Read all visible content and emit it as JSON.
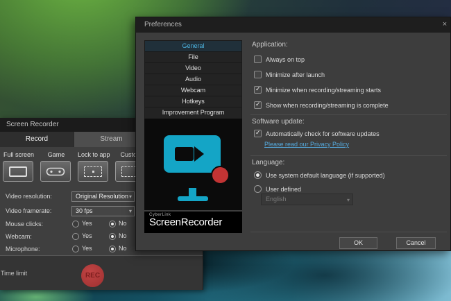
{
  "recorder_window": {
    "title": "Screen Recorder",
    "tabs": {
      "record": "Record",
      "stream": "Stream"
    },
    "modes": [
      {
        "label": "Full screen"
      },
      {
        "label": "Game"
      },
      {
        "label": "Lock to app"
      },
      {
        "label": "Custom"
      }
    ],
    "settings": [
      {
        "label": "Video resolution:",
        "value": "Original Resolution"
      },
      {
        "label": "Video framerate:",
        "value": "30 fps"
      },
      {
        "label": "Mouse clicks:",
        "yes": "Yes",
        "no": "No",
        "selected": "No"
      },
      {
        "label": "Webcam:",
        "yes": "Yes",
        "no": "No",
        "selected": "No"
      },
      {
        "label": "Microphone:",
        "yes": "Yes",
        "no": "No",
        "selected": "No"
      }
    ],
    "footer": {
      "time_limit": "Time limit",
      "rec": "REC"
    },
    "rec_button_color": "#b03a3a"
  },
  "preferences": {
    "title": "Preferences",
    "close": "×",
    "nav": {
      "items": [
        {
          "label": "General",
          "selected": true
        },
        {
          "label": "File",
          "selected": false
        },
        {
          "label": "Video",
          "selected": false
        },
        {
          "label": "Audio",
          "selected": false
        },
        {
          "label": "Webcam",
          "selected": false
        },
        {
          "label": "Hotkeys",
          "selected": false
        },
        {
          "label": "Improvement Program",
          "selected": false
        }
      ]
    },
    "logo": {
      "brand": "CyberLink",
      "product": "ScreenRecorder",
      "monitor_color": "#14a5c6",
      "dot_color": "#c23434"
    },
    "application": {
      "header": "Application:",
      "items": [
        {
          "label": "Always on top",
          "checked": false,
          "mark": ""
        },
        {
          "label": "Minimize after launch",
          "checked": false,
          "mark": ""
        },
        {
          "label": "Minimize when recording/streaming starts",
          "checked": true,
          "mark": "✓"
        },
        {
          "label": "Show when recording/streaming is complete",
          "checked": true,
          "mark": "✓"
        }
      ]
    },
    "software_update": {
      "header": "Software update:",
      "checkbox": {
        "label": "Automatically check for software updates",
        "checked": true,
        "mark": "✓"
      },
      "privacy_link": "Please read our Privacy Policy"
    },
    "language": {
      "header": "Language:",
      "system_default": {
        "label": "Use system default language (if supported)",
        "selected": true
      },
      "user_defined": {
        "label": "User defined",
        "selected": false
      },
      "dropdown": {
        "value": "English",
        "disabled": true
      }
    },
    "actions": {
      "ok": "OK",
      "cancel": "Cancel"
    },
    "accent_color": "#4db4e0",
    "link_color": "#55a9dd"
  }
}
